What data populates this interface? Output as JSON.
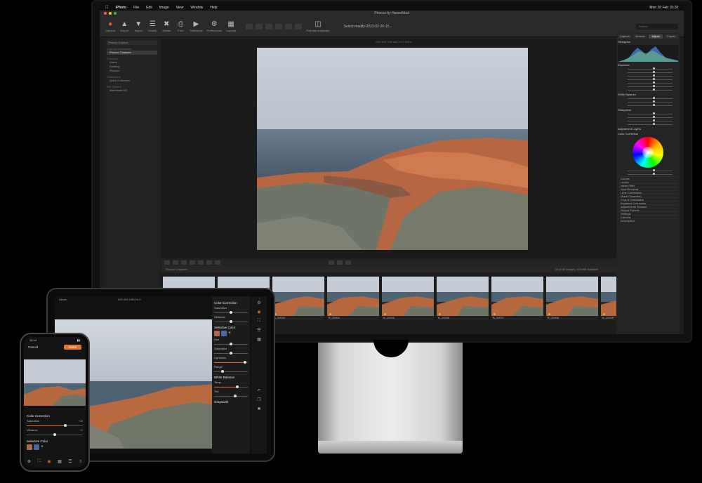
{
  "desktop": {
    "menubar": {
      "app_name": "iPhoto",
      "items": [
        "File",
        "Edit",
        "Image",
        "View",
        "Window",
        "Help"
      ],
      "clock": "Mon 26 Feb  15:28"
    },
    "window_title": "Phocus by Hasselblad",
    "toolbar": {
      "buttons": [
        {
          "label": "Camera",
          "icon": "camera-icon"
        },
        {
          "label": "Export",
          "icon": "export-icon"
        },
        {
          "label": "Import",
          "icon": "import-icon"
        },
        {
          "label": "Modify",
          "icon": "modify-icon"
        },
        {
          "label": "Delete",
          "icon": "trash-icon"
        },
        {
          "label": "Print",
          "icon": "print-icon"
        },
        {
          "label": "Slideshow",
          "icon": "slideshow-icon"
        },
        {
          "label": "Preferences",
          "icon": "preferences-icon"
        },
        {
          "label": "Layouts",
          "icon": "layouts-icon"
        }
      ],
      "show_label": "Show",
      "portrait_label": "Portrait/Landscape",
      "session_title": "Select-modify-2023-02-26-15...",
      "adjustments_label": "Adjustments",
      "search_placeholder": "Search"
    },
    "left_panel": {
      "header": "Phocus Capture",
      "sections": [
        {
          "title": "Capture Destination",
          "items": [
            "Phocus Captures"
          ]
        },
        {
          "title": "Favorites",
          "items": [
            "Users",
            "Desktop",
            "Pictures"
          ]
        },
        {
          "title": "Collections",
          "items": [
            "Quick Collection"
          ]
        },
        {
          "title": "File System",
          "items": [
            "Macintosh HD"
          ]
        }
      ]
    },
    "viewer": {
      "info": "ISO 400   1/90 sec   f/4.0   100%"
    },
    "filmstrip": {
      "folder": "Phocus Captures",
      "count_text": "30 of 30 images, 303 MB available",
      "thumbs": [
        "B_20001",
        "B_20002",
        "B_20003",
        "B_20004",
        "B_20005",
        "B_20006",
        "B_20007",
        "B_20008",
        "B_20009"
      ]
    },
    "right_panel": {
      "tabs": [
        "Capture",
        "Browse",
        "Adjust",
        "Export"
      ],
      "active_tab": "Adjust",
      "sections": [
        {
          "title": "Histogram",
          "sliders": 0
        },
        {
          "title": "Exposure",
          "sliders": 7
        },
        {
          "title": "White Balance",
          "sliders": 3
        },
        {
          "title": "Sharpness",
          "sliders": 4
        },
        {
          "title": "Adjustment Layers",
          "sliders": 0
        },
        {
          "title": "Color Correction",
          "sliders": 2
        }
      ],
      "collapsed": [
        "Curves",
        "Levels",
        "Noise Filter",
        "Dust Removal",
        "Lens Corrections",
        "Moiré Correction",
        "Crop & Orientation",
        "Keystone Correction",
        "Adjustments Browser",
        "Output Presets",
        "Settings",
        "Camera",
        "Description"
      ]
    }
  },
  "ipad": {
    "back_label": "Album",
    "info": "ISO 400   1/90 f/4.0",
    "panel": {
      "title": "Color Correction",
      "saturation_label": "Saturation",
      "vibrance_label": "Vibrance",
      "selective_label": "Selective Color",
      "hue_label": "Hue",
      "saturation2_label": "Saturation",
      "lightness_label": "Lightness",
      "range_label": "Range",
      "wb_label": "White Balance",
      "temp_label": "Temp",
      "tint_label": "Tint",
      "grayscale_label": "Grayscale",
      "sliders": {
        "saturation": 0.5,
        "vibrance": 0.5,
        "hue": 0.5,
        "saturation2": 0.5,
        "lightness": 0.92,
        "range": 0.25,
        "temp": 0.68,
        "tint": 0.62
      }
    }
  },
  "iphone": {
    "status_time": "10:14",
    "cancel_label": "Cancel",
    "done_label": "Done",
    "panel_title": "Color Correction",
    "saturation_label": "Saturation",
    "saturation_value": "+38",
    "vibrance_label": "Vibrance",
    "vibrance_value": "+0",
    "selective_label": "Selective Color",
    "sliders": {
      "saturation": 0.69,
      "vibrance": 0.5
    }
  },
  "colors": {
    "accent": "#d8662a",
    "sky": "#b9c2cf",
    "sea": "#4a5c6c",
    "rock_orange": "#c06a42",
    "rock_gray": "#6e7466"
  }
}
